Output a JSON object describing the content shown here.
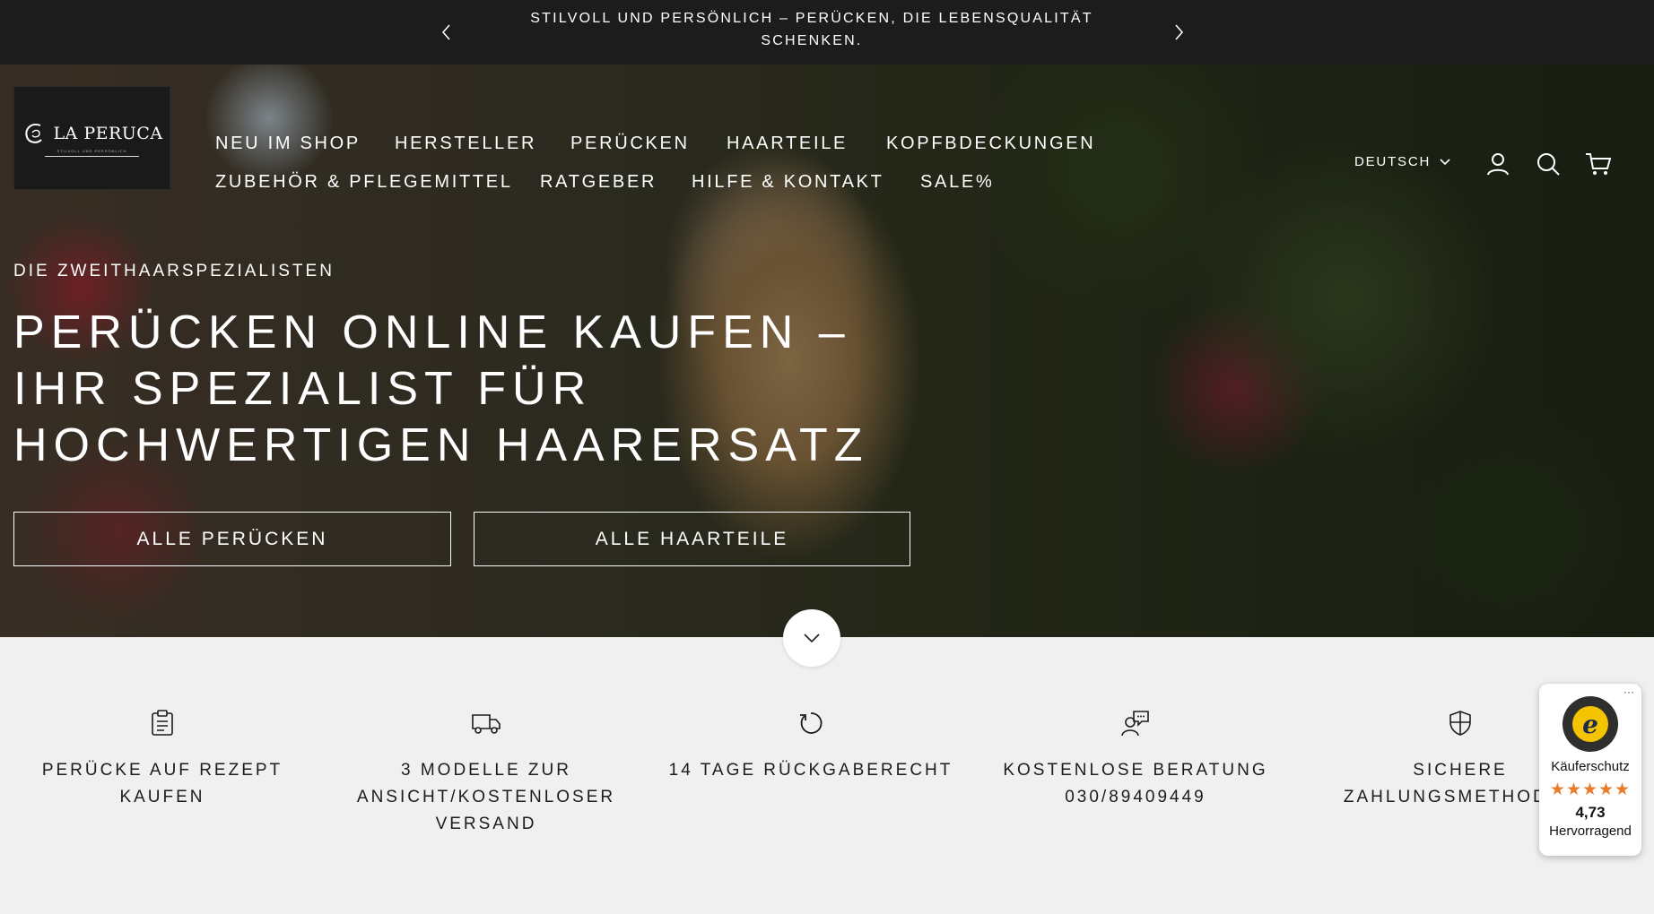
{
  "announcement": {
    "text": "STILVOLL UND PERSÖNLICH – PERÜCKEN, DIE LEBENSQUALITÄT SCHENKEN."
  },
  "logo": {
    "name": "LA PERUCA",
    "tagline": "STILVOLL UND PERSÖNLICH"
  },
  "nav": {
    "items": [
      "NEU IM SHOP",
      "HERSTELLER",
      "PERÜCKEN",
      "HAARTEILE",
      "KOPFBDECKUNGEN",
      "ZUBEHÖR & PFLEGEMITTEL",
      "RATGEBER",
      "HILFE & KONTAKT",
      "SALE%"
    ]
  },
  "header": {
    "language": "DEUTSCH",
    "icons": [
      "account-icon",
      "search-icon",
      "cart-icon"
    ]
  },
  "hero": {
    "eyebrow": "DIE ZWEITHAARSPEZIALISTEN",
    "headline": "PERÜCKEN ONLINE KAUFEN – IHR SPEZIALIST FÜR HOCHWERTIGEN HAARERSATZ",
    "buttons": [
      "ALLE PERÜCKEN",
      "ALLE HAARTEILE"
    ]
  },
  "features": [
    {
      "icon": "clipboard-icon",
      "text": "PERÜCKE AUF REZEPT KAUFEN"
    },
    {
      "icon": "delivery-truck-icon",
      "text": "3 MODELLE ZUR ANSICHT/KOSTENLOSER VERSAND"
    },
    {
      "icon": "return-arrow-icon",
      "text": "14 TAGE RÜCKGABERECHT"
    },
    {
      "icon": "consultation-icon",
      "text": "KOSTENLOSE BERATUNG 030/89409449"
    },
    {
      "icon": "shield-icon",
      "text": "SICHERE ZAHLUNGSMETHODEN"
    }
  ],
  "trusted_badge": {
    "title": "Käuferschutz",
    "stars": "★★★★★",
    "score": "4,73",
    "label": "Hervorragend",
    "menu": "···"
  },
  "colors": {
    "dark": "#1c1c1c",
    "light_bg": "#f0f0f0",
    "star": "#e97c2b"
  }
}
